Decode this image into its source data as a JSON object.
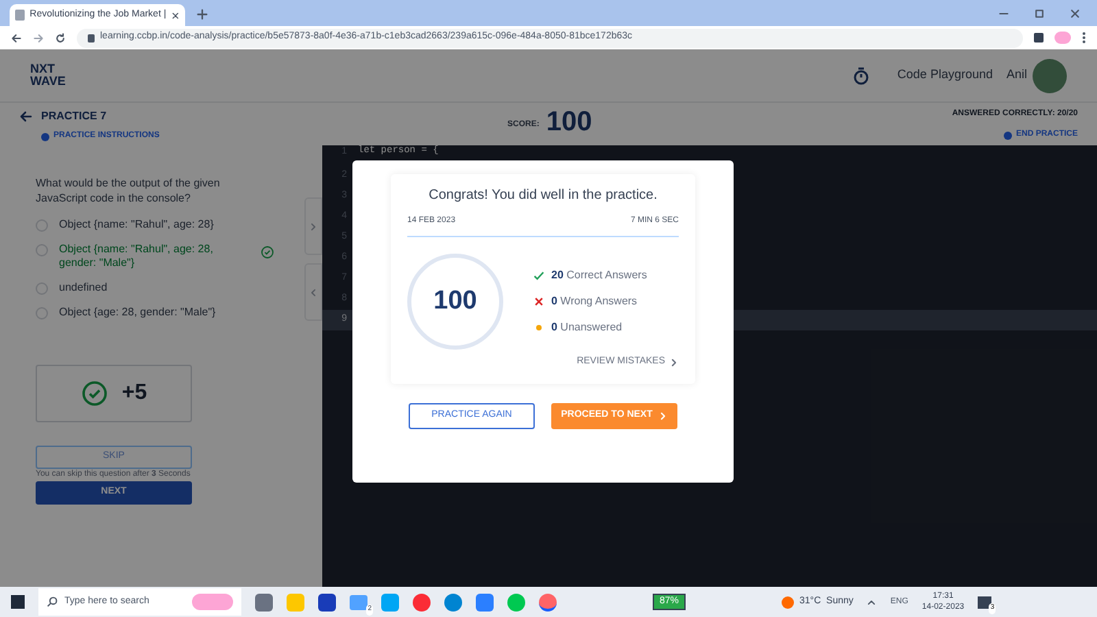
{
  "browser": {
    "tab_title": "Revolutionizing the Job Market |",
    "url": "learning.ccbp.in/code-analysis/practice/b5e57873-8a0f-4e36-a71b-c1eb3cad2663/239a615c-096e-484a-8050-81bce172b63c"
  },
  "header": {
    "logo_line1": "NXT",
    "logo_line2": "WAVE",
    "playground": "Code Playground",
    "user": "Anil"
  },
  "practice_bar": {
    "title": "PRACTICE 7",
    "instructions": "PRACTICE INSTRUCTIONS",
    "score_label": "SCORE:",
    "score": "100",
    "answered": "ANSWERED CORRECTLY: 20/20",
    "end": "END PRACTICE"
  },
  "question": {
    "text": "What would be the output of the given JavaScript code in the console?",
    "options": [
      {
        "label": "Object {name: \"Rahul\", age: 28}",
        "correct": false,
        "selected": false
      },
      {
        "label": "Object {name: \"Rahul\", age: 28, gender: \"Male\"}",
        "correct": true,
        "selected": false
      },
      {
        "label": "undefined",
        "correct": false,
        "selected": false
      },
      {
        "label": "Object {age: 28, gender: \"Male\"}",
        "correct": false,
        "selected": false
      }
    ],
    "points": "+5",
    "skip": "SKIP",
    "skip_note": "You can skip this question after **3** Seconds",
    "next": "NEXT"
  },
  "editor": {
    "line_numbers": [
      "1",
      "2",
      "3",
      "4",
      "5",
      "6",
      "7",
      "8",
      "9"
    ],
    "first_line": "let person = {"
  },
  "modal": {
    "title": "Congrats! You did well in the practice.",
    "date": "14 FEB 2023",
    "duration": "7 MIN 6 SEC",
    "score": "100",
    "stats": [
      {
        "kind": "correct",
        "count": "20",
        "label": "Correct Answers"
      },
      {
        "kind": "wrong",
        "count": "0",
        "label": "Wrong Answers"
      },
      {
        "kind": "unanswered",
        "count": "0",
        "label": "Unanswered"
      }
    ],
    "review": "REVIEW MISTAKES",
    "practice_again": "PRACTICE AGAIN",
    "proceed": "PROCEED TO NEXT"
  },
  "taskbar": {
    "search_placeholder": "Type here to search",
    "mail_badge": "2",
    "battery": "87%",
    "weather": "31°C  Sunny",
    "language": "ENG",
    "time": "17:31",
    "date": "14-02-2023",
    "notifications": "3"
  }
}
